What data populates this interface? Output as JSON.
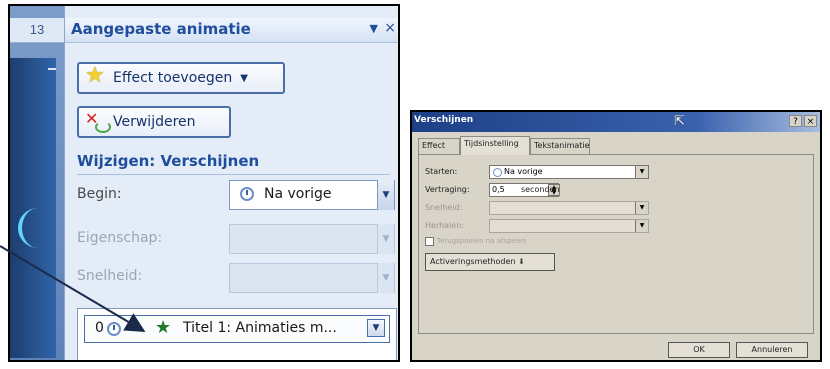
{
  "left_panel": {
    "slide_number": "13",
    "pane_title": "Aangepaste animatie",
    "pane_dropdown_glyph": "▼",
    "pane_close_glyph": "×",
    "add_effect_label": "Effect toevoegen",
    "add_effect_caret": "▼",
    "remove_label": "Verwijderen",
    "modify_title": "Wijzigen: Verschijnen",
    "begin_label": "Begin:",
    "begin_value": "Na vorige",
    "property_label": "Eigenschap:",
    "speed_label": "Snelheid:",
    "dropdown_glyph": "▼",
    "animation_item": {
      "index": "0",
      "text": "Titel 1: Animaties m..."
    }
  },
  "dialog": {
    "title": "Verschijnen",
    "help_glyph": "?",
    "close_glyph": "×",
    "tabs": [
      "Effect",
      "Tijdsinstelling",
      "Tekstanimatie"
    ],
    "start_label": "Starten:",
    "start_value": "Na vorige",
    "delay_label": "Vertraging:",
    "delay_value": "0,5",
    "delay_unit": "seconden",
    "speed_label": "Snelheid:",
    "repeat_label": "Herhalen:",
    "rewind_label": "Terugspoelen na afspelen",
    "triggers_label": "Activeringsmethoden ⇟",
    "ok_label": "OK",
    "cancel_label": "Annuleren"
  },
  "colors": {
    "pane_title": "#1f4e9c",
    "arrow": "#1a2a4a"
  },
  "icons": [
    "star-icon",
    "remove-effect-icon",
    "clock-icon",
    "green-star-icon",
    "mouse-cursor-icon"
  ]
}
